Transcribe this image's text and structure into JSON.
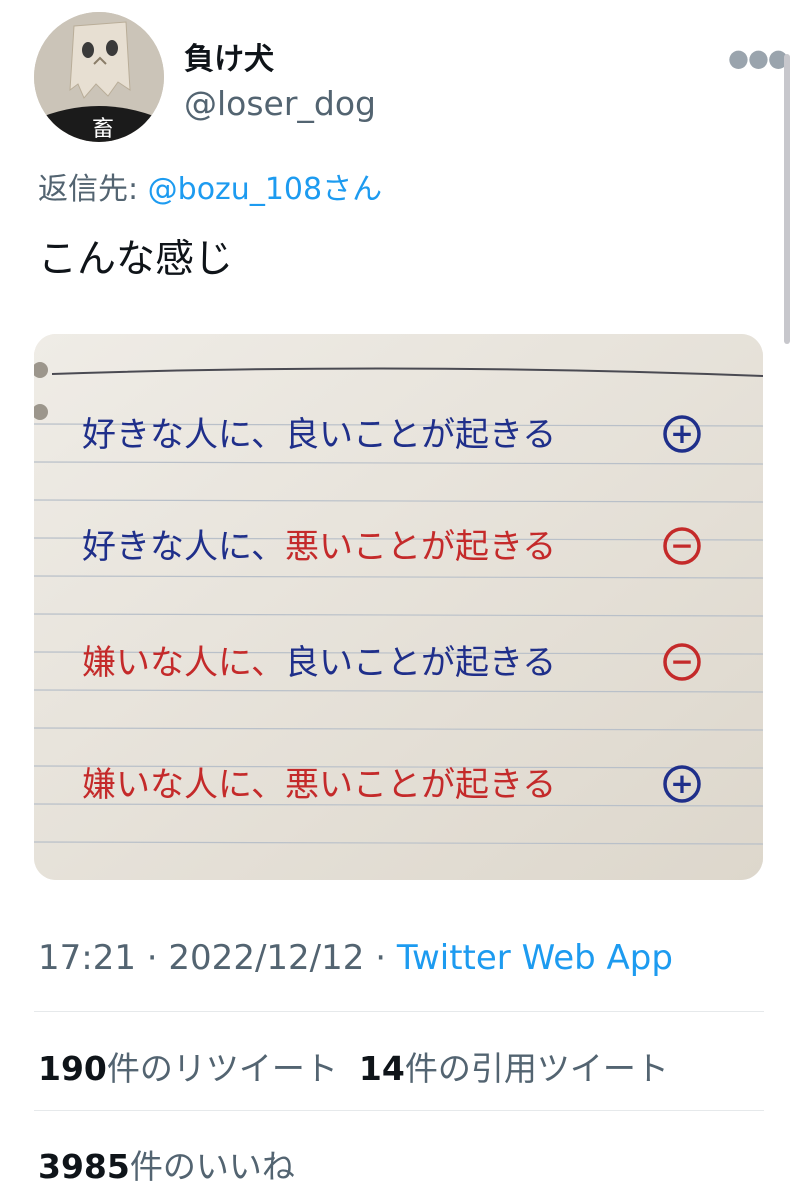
{
  "user": {
    "display_name": "負け犬",
    "handle": "@loser_dog",
    "avatar_shirt_glyph": "畜"
  },
  "more_icon": "more-horizontal-icon",
  "reply": {
    "label": "返信先:",
    "mention": "@bozu_108さん"
  },
  "tweet": {
    "text": "こんな感じ"
  },
  "photo": {
    "rows": [
      {
        "part1": "好きな人に、",
        "part2": "良いことが起きる",
        "symbol": "+",
        "color1": "#1f2f8a",
        "color2": "#1f2f8a",
        "symbol_color": "#1f2f8a"
      },
      {
        "part1": "好きな人に、",
        "part2": "悪いことが起きる",
        "symbol": "−",
        "color1": "#1f2f8a",
        "color2": "#c42a2a",
        "symbol_color": "#c42a2a"
      },
      {
        "part1": "嫌いな人に、",
        "part2": "良いことが起きる",
        "symbol": "−",
        "color1": "#c42a2a",
        "color2": "#1f2f8a",
        "symbol_color": "#c42a2a"
      },
      {
        "part1": "嫌いな人に、",
        "part2": "悪いことが起きる",
        "symbol": "+",
        "color1": "#c42a2a",
        "color2": "#c42a2a",
        "symbol_color": "#1f2f8a"
      }
    ]
  },
  "meta": {
    "time": "17:21",
    "sep": " · ",
    "date": "2022/12/12",
    "source": "Twitter Web App"
  },
  "stats": {
    "retweets_count": "190",
    "retweets_label": "件のリツイート",
    "quotes_count": "14",
    "quotes_label": "件の引用ツイート",
    "likes_count": "3985",
    "likes_label": "件のいいね"
  },
  "colors": {
    "link": "#1d9bf0",
    "secondary": "#536471",
    "primary": "#0f1419"
  }
}
